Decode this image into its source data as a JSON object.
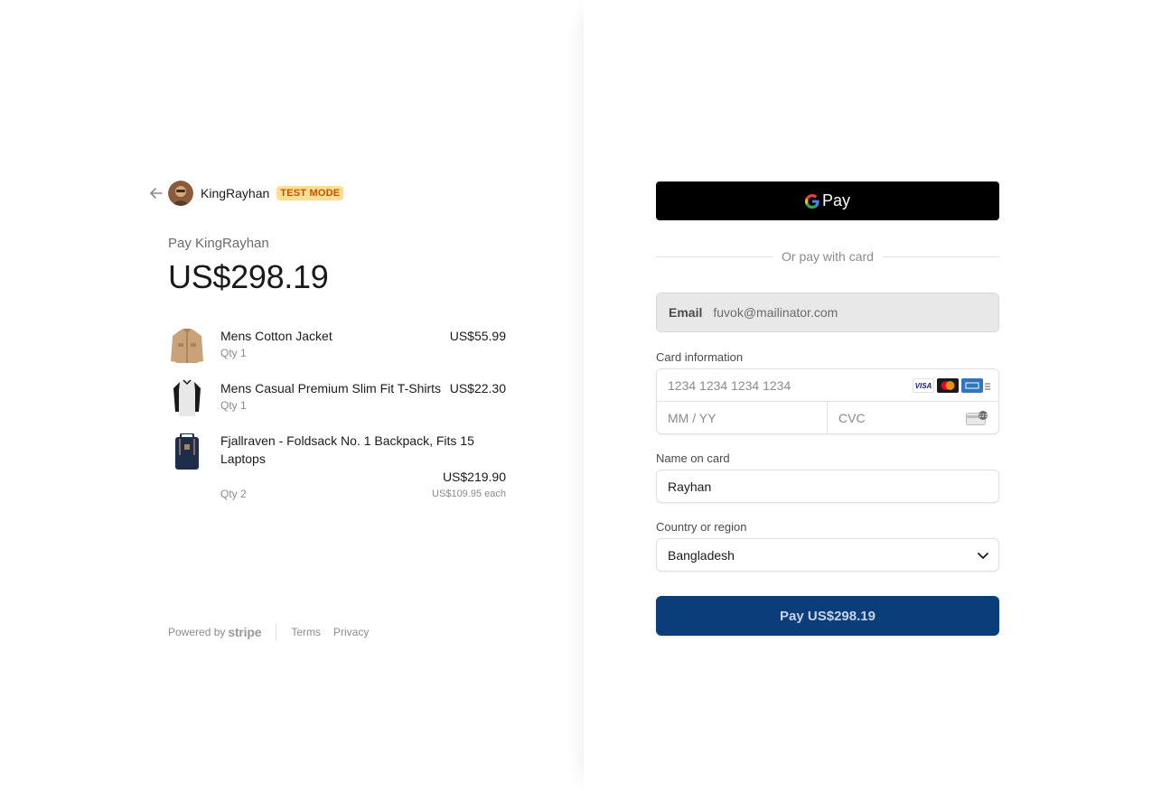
{
  "merchant": {
    "name": "KingRayhan",
    "badge": "TEST MODE"
  },
  "summary": {
    "pay_label": "Pay KingRayhan",
    "total": "US$298.19"
  },
  "items": [
    {
      "name": "Mens Cotton Jacket",
      "qty": "Qty 1",
      "price": "US$55.99"
    },
    {
      "name": "Mens Casual Premium Slim Fit T-Shirts",
      "qty": "Qty 1",
      "price": "US$22.30"
    },
    {
      "name": "Fjallraven - Foldsack No. 1 Backpack, Fits 15 Laptops",
      "qty": "Qty 2",
      "price": "US$219.90",
      "each": "US$109.95 each"
    }
  ],
  "footer": {
    "powered_by": "Powered by",
    "stripe": "stripe",
    "terms": "Terms",
    "privacy": "Privacy"
  },
  "payment": {
    "gpay_label": "Pay",
    "or_text": "Or pay with card",
    "email_label": "Email",
    "email_value": "fuvok@mailinator.com",
    "card_info_label": "Card information",
    "card_number_placeholder": "1234 1234 1234 1234",
    "expiry_placeholder": "MM / YY",
    "cvc_placeholder": "CVC",
    "brands": [
      "VISA"
    ],
    "name_label": "Name on card",
    "name_value": "Rayhan",
    "country_label": "Country or region",
    "country_value": "Bangladesh",
    "pay_button": "Pay US$298.19"
  },
  "colors": {
    "badge_bg": "#ffde92",
    "badge_text": "#bb5504",
    "pay_button_bg": "#0a3d7a",
    "gpay_bg": "#000000"
  }
}
